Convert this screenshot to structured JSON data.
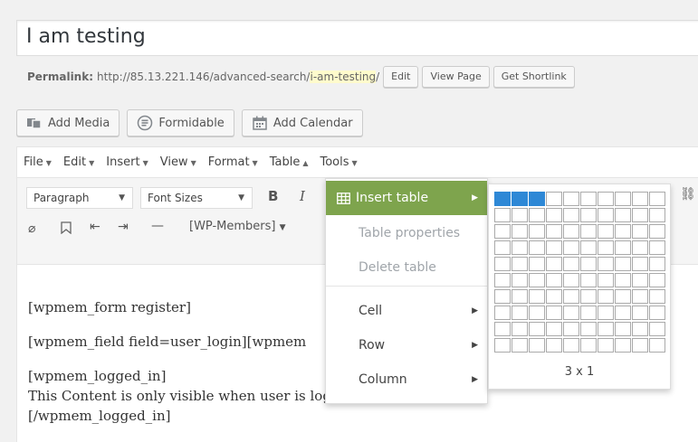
{
  "title": "I am testing",
  "permalink": {
    "label": "Permalink:",
    "url_base": "http://85.13.221.146/advanced-search/",
    "slug": "i-am-testing",
    "trailing": "/",
    "buttons": [
      "Edit",
      "View Page",
      "Get Shortlink"
    ]
  },
  "media_buttons": [
    {
      "label": "Add Media",
      "icon": "add-media-icon"
    },
    {
      "label": "Formidable",
      "icon": "formidable-icon"
    },
    {
      "label": "Add Calendar",
      "icon": "calendar-icon"
    }
  ],
  "menubar": [
    "File",
    "Edit",
    "Insert",
    "View",
    "Format",
    "Table",
    "Tools"
  ],
  "toolbar": {
    "paragraph": "Paragraph",
    "font_sizes": "Font Sizes",
    "bold": "B",
    "italic": "I",
    "members": "[WP-Members]"
  },
  "content": [
    "[wpmem_form register]",
    "[wpmem_field field=user_login][wpmem",
    "[wpmem_logged_in]",
    "This Content is only visible when user is logged in",
    "[/wpmem_logged_in]"
  ],
  "table_menu": {
    "insert_table": "Insert table",
    "table_properties": "Table properties",
    "delete_table": "Delete table",
    "cell": "Cell",
    "row": "Row",
    "column": "Column"
  },
  "grid": {
    "cols": 10,
    "rows": 10,
    "selected_cols": 3,
    "selected_rows": 1,
    "label": "3 x 1"
  },
  "colors": {
    "accent": "#7ea44d",
    "selection": "#2e88d6"
  }
}
